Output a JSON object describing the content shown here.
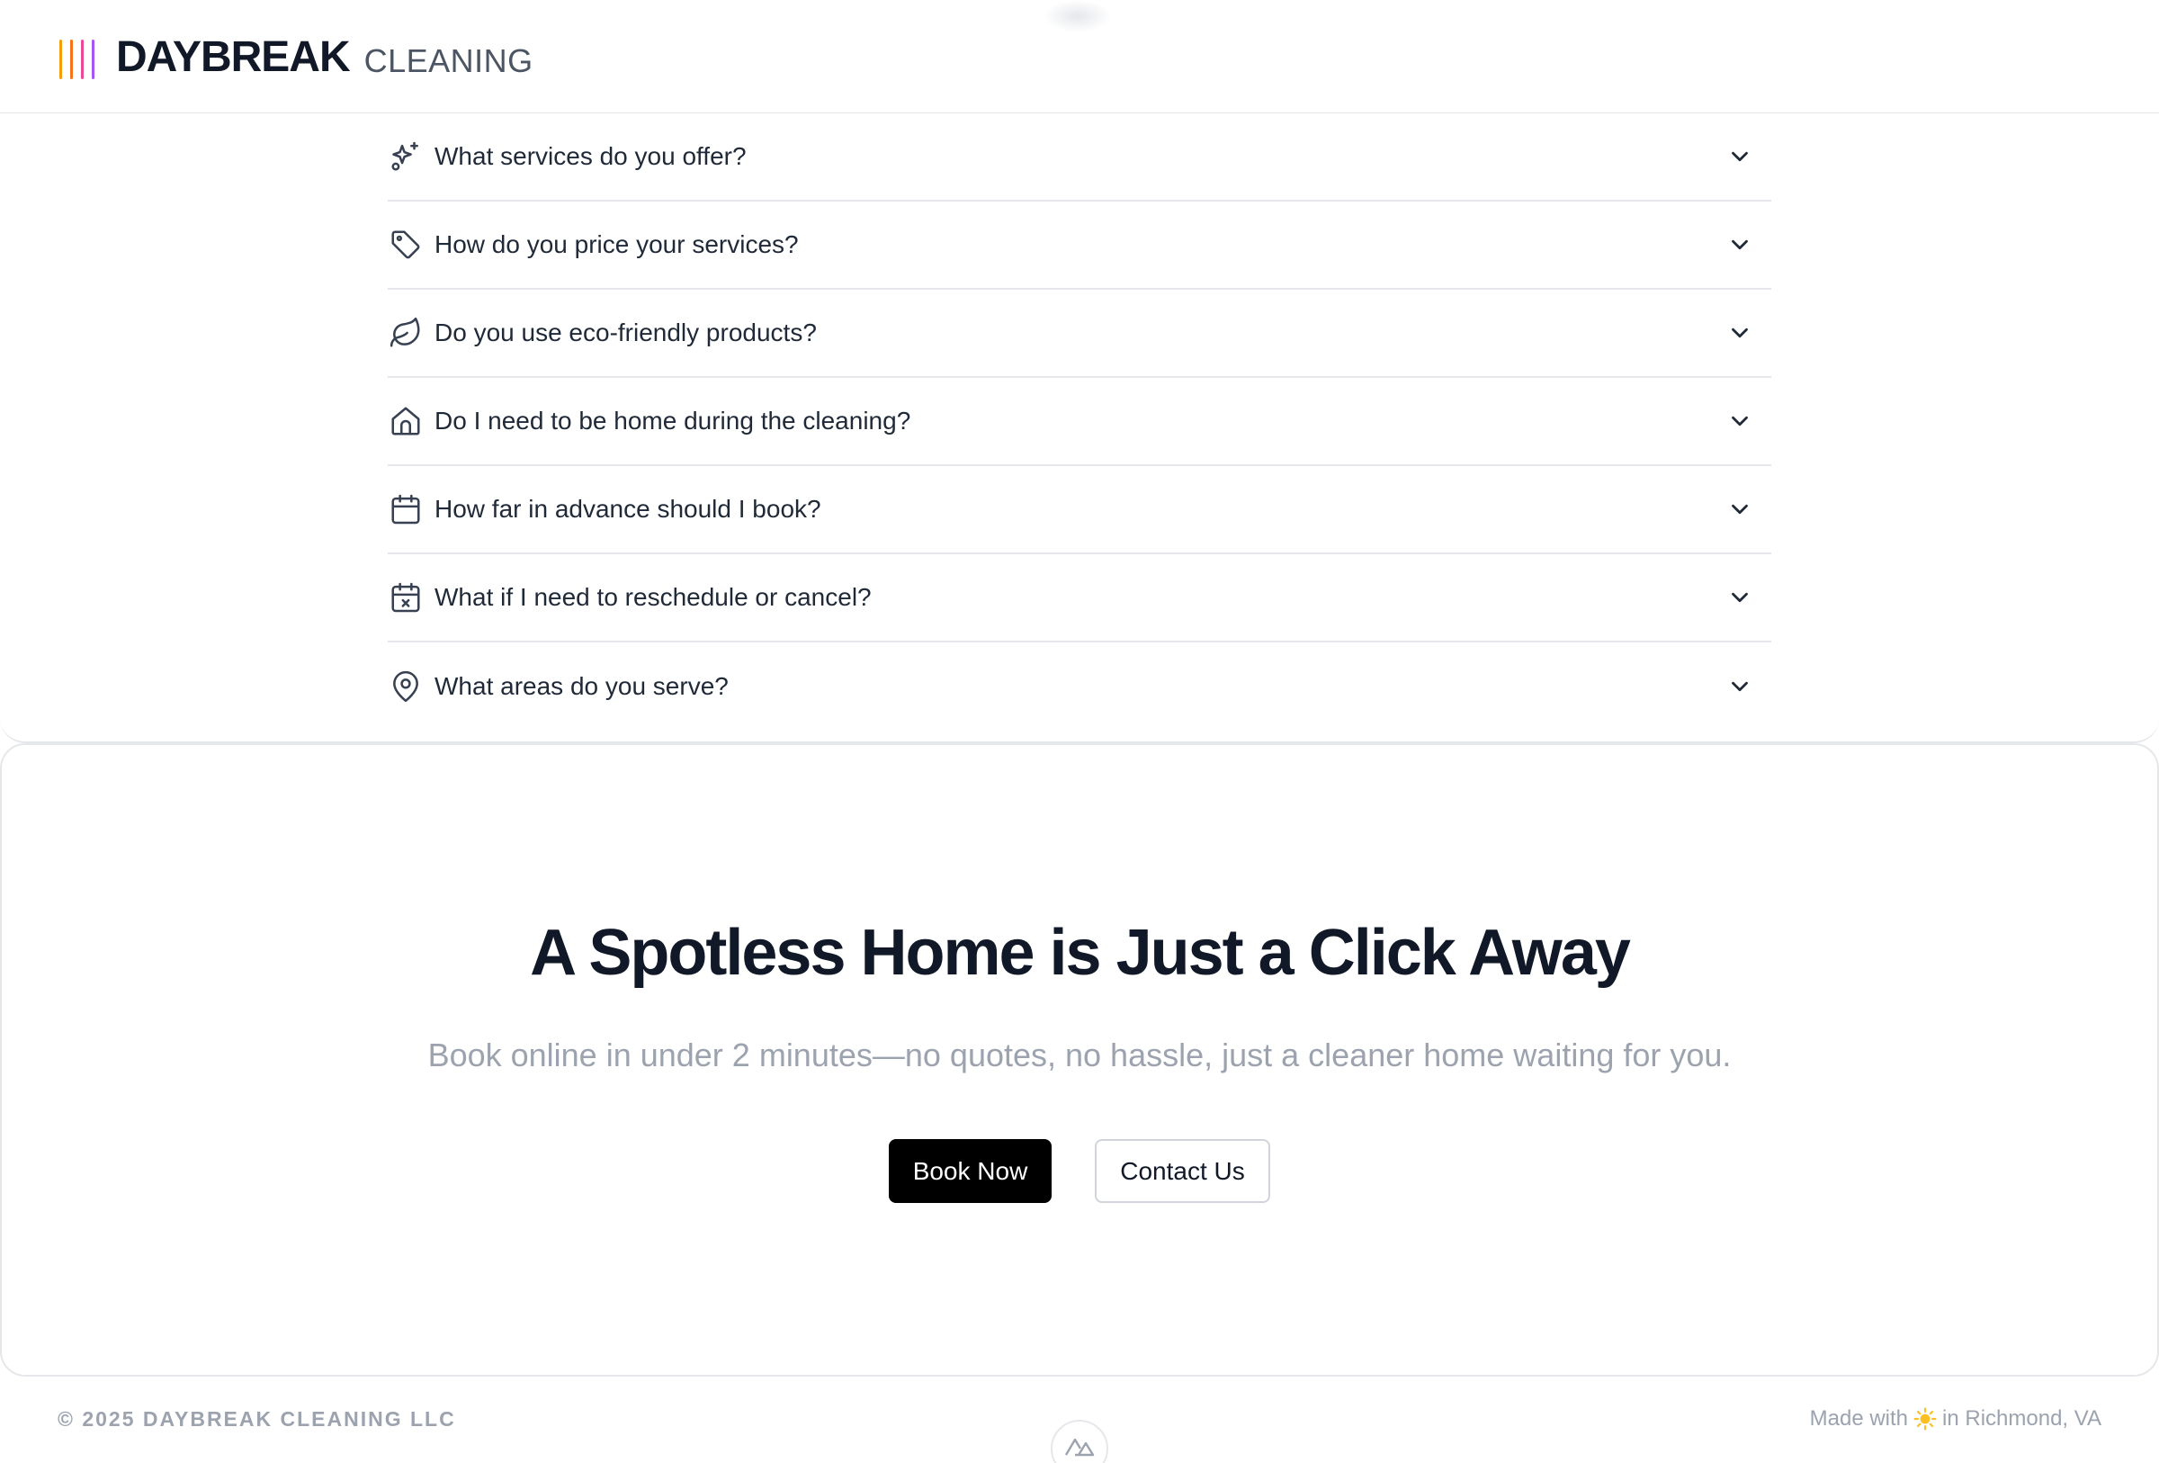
{
  "brand": {
    "name": "DAYBREAK",
    "sub": "CLEANING",
    "bar_colors": [
      "#f59e0b",
      "#f97316",
      "#ec4899",
      "#a855f7"
    ]
  },
  "faq": {
    "items": [
      {
        "question": "What services do you offer?",
        "icon": "sparkles-icon"
      },
      {
        "question": "How do you price your services?",
        "icon": "tag-icon"
      },
      {
        "question": "Do you use eco-friendly products?",
        "icon": "leaf-icon"
      },
      {
        "question": "Do I need to be home during the cleaning?",
        "icon": "home-icon"
      },
      {
        "question": "How far in advance should I book?",
        "icon": "calendar-icon"
      },
      {
        "question": "What if I need to reschedule or cancel?",
        "icon": "calendar-x-icon"
      },
      {
        "question": "What areas do you serve?",
        "icon": "map-pin-icon"
      }
    ]
  },
  "cta": {
    "title": "A Spotless Home is Just a Click Away",
    "subtitle": "Book online in under 2 minutes—no quotes, no hassle, just a cleaner home waiting for you.",
    "primary_label": "Book Now",
    "secondary_label": "Contact Us"
  },
  "footer": {
    "copyright": "© 2025 DAYBREAK CLEANING LLC",
    "made_with_prefix": "Made with",
    "made_with_suffix": "in Richmond, VA",
    "sun_color": "#fbbf24"
  }
}
